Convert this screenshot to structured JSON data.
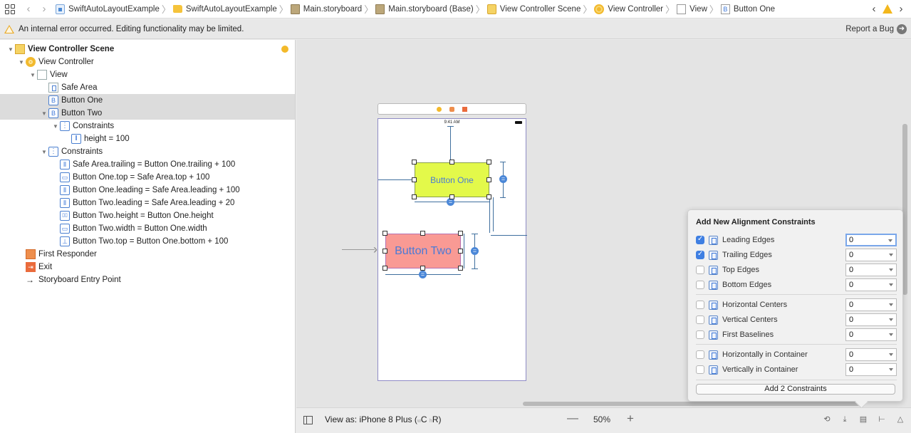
{
  "toolbar": {
    "grid_icon": "related-items-grid-icon",
    "back_icon": "chevron-left-icon",
    "forward_icon": "chevron-right-icon",
    "breadcrumbs": [
      {
        "label": "SwiftAutoLayoutExample",
        "icon": "project-file-icon"
      },
      {
        "label": "SwiftAutoLayoutExample",
        "icon": "folder-icon"
      },
      {
        "label": "Main.storyboard",
        "icon": "storyboard-icon"
      },
      {
        "label": "Main.storyboard (Base)",
        "icon": "storyboard-icon"
      },
      {
        "label": "View Controller Scene",
        "icon": "scene-icon"
      },
      {
        "label": "View Controller",
        "icon": "view-controller-icon"
      },
      {
        "label": "View",
        "icon": "view-icon"
      },
      {
        "label": "Button One",
        "icon": "button-icon"
      }
    ],
    "separator": "〉",
    "prev_issue": "‹",
    "next_issue": "›"
  },
  "warning": {
    "message": "An internal error occurred. Editing functionality may be limited.",
    "report_label": "Report a Bug",
    "report_arrow": "➜"
  },
  "outline": {
    "disclosure_open": "▼",
    "items": [
      {
        "label": "View Controller Scene",
        "icon": "scene-icon",
        "expanded": true,
        "selected": false
      },
      {
        "label": "View Controller",
        "icon": "view-controller-icon",
        "expanded": true,
        "selected": false
      },
      {
        "label": "View",
        "icon": "view-icon",
        "expanded": true,
        "selected": false
      },
      {
        "label": "Safe Area",
        "icon": "safe-area-icon",
        "selected": false
      },
      {
        "label": "Button One",
        "icon": "button-icon",
        "selected": true
      },
      {
        "label": "Button Two",
        "icon": "button-icon",
        "expanded": true,
        "selected": true
      },
      {
        "label": "Constraints",
        "icon": "constraints-icon",
        "expanded": true,
        "selected": false
      },
      {
        "label": "height = 100",
        "icon": "height-constraint-icon",
        "selected": false
      },
      {
        "label": "Constraints",
        "icon": "constraints-icon",
        "expanded": true,
        "selected": false
      },
      {
        "label": "Safe Area.trailing = Button One.trailing + 100",
        "icon": "trailing-constraint-icon"
      },
      {
        "label": "Button One.top = Safe Area.top + 100",
        "icon": "top-constraint-icon"
      },
      {
        "label": "Button One.leading = Safe Area.leading + 100",
        "icon": "leading-constraint-icon"
      },
      {
        "label": "Button Two.leading = Safe Area.leading + 20",
        "icon": "leading-constraint-icon"
      },
      {
        "label": "Button Two.height = Button One.height",
        "icon": "equal-height-constraint-icon"
      },
      {
        "label": "Button Two.width = Button One.width",
        "icon": "equal-width-constraint-icon"
      },
      {
        "label": "Button Two.top = Button One.bottom + 100",
        "icon": "vertical-spacing-constraint-icon"
      },
      {
        "label": "First Responder",
        "icon": "first-responder-icon"
      },
      {
        "label": "Exit",
        "icon": "exit-icon"
      },
      {
        "label": "Storyboard Entry Point",
        "icon": "entry-arrow-icon",
        "glyph": "→"
      }
    ]
  },
  "canvas": {
    "status_time": "9:41 AM",
    "button_one": {
      "label": "Button One",
      "color": "#e3f94a"
    },
    "button_two": {
      "label": "Button Two",
      "color": "#f99a94"
    },
    "equal_badge": "=",
    "scene_dock_colors": [
      "#f3b92a",
      "#ee8e4c",
      "#ea6b3c"
    ]
  },
  "alignment_popover": {
    "title": "Add New Alignment Constraints",
    "rows": [
      {
        "label": "Leading Edges",
        "checked": true,
        "value": "0",
        "icon": "leading-edges-icon",
        "focused": true
      },
      {
        "label": "Trailing Edges",
        "checked": true,
        "value": "0",
        "icon": "trailing-edges-icon"
      },
      {
        "label": "Top Edges",
        "checked": false,
        "value": "0",
        "icon": "top-edges-icon"
      },
      {
        "label": "Bottom Edges",
        "checked": false,
        "value": "0",
        "icon": "bottom-edges-icon"
      },
      {
        "label": "Horizontal Centers",
        "checked": false,
        "value": "0",
        "icon": "horizontal-centers-icon"
      },
      {
        "label": "Vertical Centers",
        "checked": false,
        "value": "0",
        "icon": "vertical-centers-icon"
      },
      {
        "label": "First Baselines",
        "checked": false,
        "value": "0",
        "icon": "first-baselines-icon"
      },
      {
        "label": "Horizontally in Container",
        "checked": false,
        "value": "0",
        "icon": "horizontally-in-container-icon"
      },
      {
        "label": "Vertically in Container",
        "checked": false,
        "value": "0",
        "icon": "vertically-in-container-icon"
      }
    ],
    "add_button": "Add 2 Constraints"
  },
  "bottom_bar": {
    "view_as_prefix": "View as: iPhone 8 Plus (",
    "w_label": "w",
    "w_value": "C",
    "h_label": "h",
    "h_value": "R",
    "view_as_suffix": ")",
    "zoom_minus": "—",
    "zoom_level": "50%",
    "zoom_plus": "+",
    "tools": [
      {
        "name": "update-frames-icon",
        "glyph": "⟲"
      },
      {
        "name": "embed-in-icon",
        "glyph": "⤓"
      },
      {
        "name": "align-icon",
        "glyph": "▤"
      },
      {
        "name": "add-constraints-icon",
        "glyph": "⊢"
      },
      {
        "name": "resolve-issues-icon",
        "glyph": "△"
      }
    ]
  }
}
